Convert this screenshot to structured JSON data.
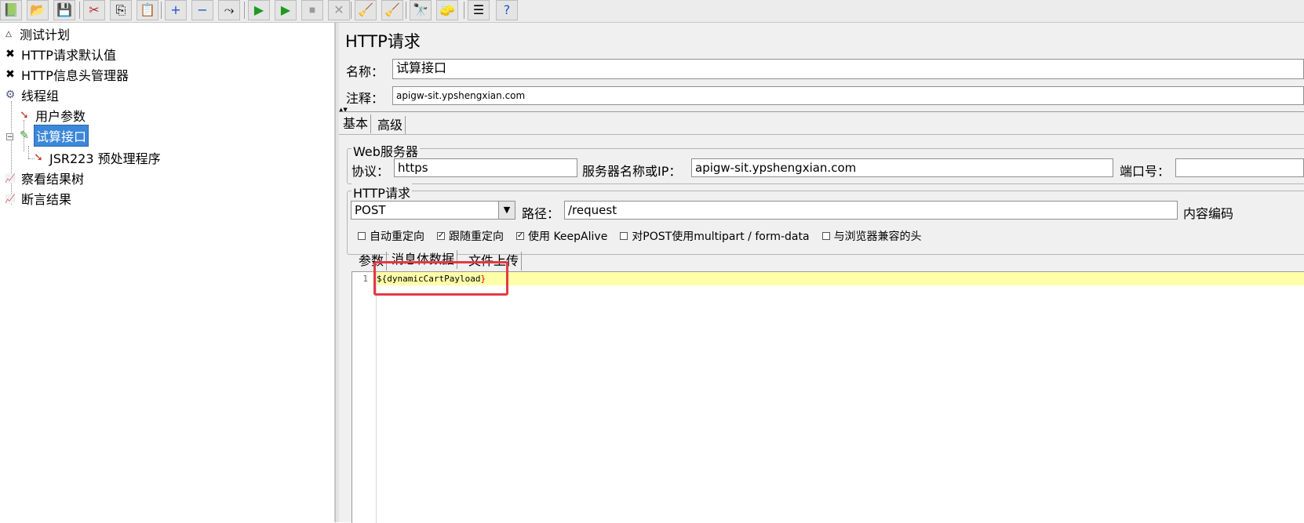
{
  "toolbar": {
    "buttons": [
      {
        "icon": "templates-icon",
        "glyph": "📗"
      },
      {
        "icon": "open-icon",
        "glyph": "📂"
      },
      {
        "icon": "save-icon",
        "glyph": "💾"
      },
      {
        "icon": "cut-icon",
        "glyph": "✂"
      },
      {
        "icon": "copy-icon",
        "glyph": "⎘"
      },
      {
        "icon": "paste-icon",
        "glyph": "📋"
      },
      {
        "icon": "expand-icon",
        "glyph": "+"
      },
      {
        "icon": "collapse-icon",
        "glyph": "−"
      },
      {
        "icon": "toggle-icon",
        "glyph": "⤳"
      },
      {
        "icon": "start-icon",
        "glyph": "▶"
      },
      {
        "icon": "start-no-pause-icon",
        "glyph": "▶"
      },
      {
        "icon": "stop-icon",
        "glyph": "⏹"
      },
      {
        "icon": "shutdown-icon",
        "glyph": "✕"
      },
      {
        "icon": "clear-icon",
        "glyph": "🧹"
      },
      {
        "icon": "clear-all-icon",
        "glyph": "🧹"
      },
      {
        "icon": "search-icon",
        "glyph": "🔭"
      },
      {
        "icon": "reset-search-icon",
        "glyph": "🧽"
      },
      {
        "icon": "function-helper-icon",
        "glyph": "☰"
      },
      {
        "icon": "help-icon",
        "glyph": "?"
      }
    ]
  },
  "tree": {
    "items": [
      {
        "label": "测试计划",
        "icon": "test-plan-icon",
        "glyph": "△"
      },
      {
        "label": "HTTP请求默认值",
        "icon": "config-icon",
        "glyph": "✖"
      },
      {
        "label": "HTTP信息头管理器",
        "icon": "config-icon",
        "glyph": "✖"
      },
      {
        "label": "线程组",
        "icon": "thread-group-icon",
        "glyph": "⚙"
      },
      {
        "label": "用户参数",
        "icon": "preprocessor-icon",
        "glyph": "➘"
      },
      {
        "label": "试算接口",
        "icon": "sampler-icon",
        "glyph": "✎",
        "selected": true
      },
      {
        "label": "JSR223 预处理程序",
        "icon": "preprocessor-icon",
        "glyph": "➘"
      },
      {
        "label": "察看结果树",
        "icon": "listener-icon",
        "glyph": "📈"
      },
      {
        "label": "断言结果",
        "icon": "listener-icon",
        "glyph": "📈"
      }
    ]
  },
  "panel": {
    "title": "HTTP请求",
    "name_label": "名称：",
    "name_value": "试算接口",
    "comment_label": "注释：",
    "comment_value": "apigw-sit.ypshengxian.com",
    "tabs": [
      "基本",
      "高级"
    ],
    "web_server": {
      "group_title": "Web服务器",
      "protocol_label": "协议：",
      "protocol_value": "https",
      "server_label": "服务器名称或IP：",
      "server_value": "apigw-sit.ypshengxian.com",
      "port_label": "端口号：",
      "port_value": ""
    },
    "http_request": {
      "group_title": "HTTP请求",
      "method": "POST",
      "path_label": "路径：",
      "path_value": "/request",
      "encoding_label": "内容编码"
    },
    "checkboxes": [
      {
        "label": "自动重定向",
        "checked": false
      },
      {
        "label": "跟随重定向",
        "checked": true
      },
      {
        "label": "使用 KeepAlive",
        "checked": true
      },
      {
        "label": "对POST使用multipart / form-data",
        "checked": false
      },
      {
        "label": "与浏览器兼容的头",
        "checked": false
      }
    ],
    "body_tabs": [
      "参数",
      "消息体数据",
      "文件上传"
    ],
    "editor": {
      "line_number": "1",
      "code_prefix": "${",
      "code_var": "dynamicCartPayload",
      "code_suffix": "}"
    }
  },
  "colors": {
    "highlight_box": "#e53944",
    "selected_tree": "#3b87d9",
    "current_line": "#ffffaa"
  }
}
